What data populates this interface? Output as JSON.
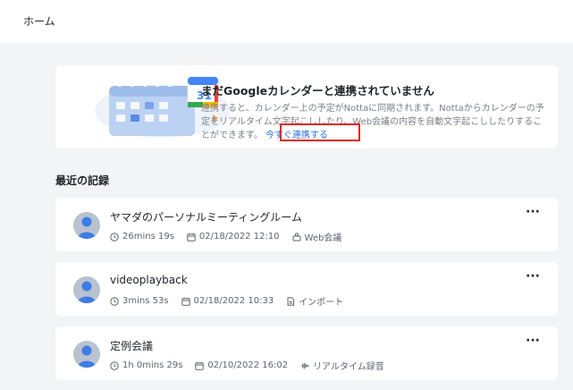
{
  "header": {
    "title": "ホーム"
  },
  "banner": {
    "title": "まだGoogleカレンダーと連携されていません",
    "description": "連携すると、カレンダー上の予定がNottaに同期されます。Nottaからカレンダーの予定をリアルタイム文字起こししたり、Web会議の内容を自動文字起こししたりすることができます。",
    "link_label": "今すぐ連携する",
    "calendar_badge": "31"
  },
  "recent": {
    "title": "最近の記録",
    "records": [
      {
        "title": "ヤマダのパーソナルミーティングルーム",
        "duration": "26mins 19s",
        "date": "02/18/2022 12:10",
        "source": "Web会議",
        "source_icon": "web-meeting-icon"
      },
      {
        "title": "videoplayback",
        "duration": "3mins 53s",
        "date": "02/18/2022 10:33",
        "source": "インポート",
        "source_icon": "import-icon"
      },
      {
        "title": "定例会議",
        "duration": "1h 0mins 29s",
        "date": "02/10/2022 16:02",
        "source": "リアルタイム録音",
        "source_icon": "waveform-icon"
      }
    ],
    "more_label": "···"
  },
  "colors": {
    "link": "#2f6fdf",
    "highlight": "#e0261b",
    "background": "#f3f4f6"
  }
}
